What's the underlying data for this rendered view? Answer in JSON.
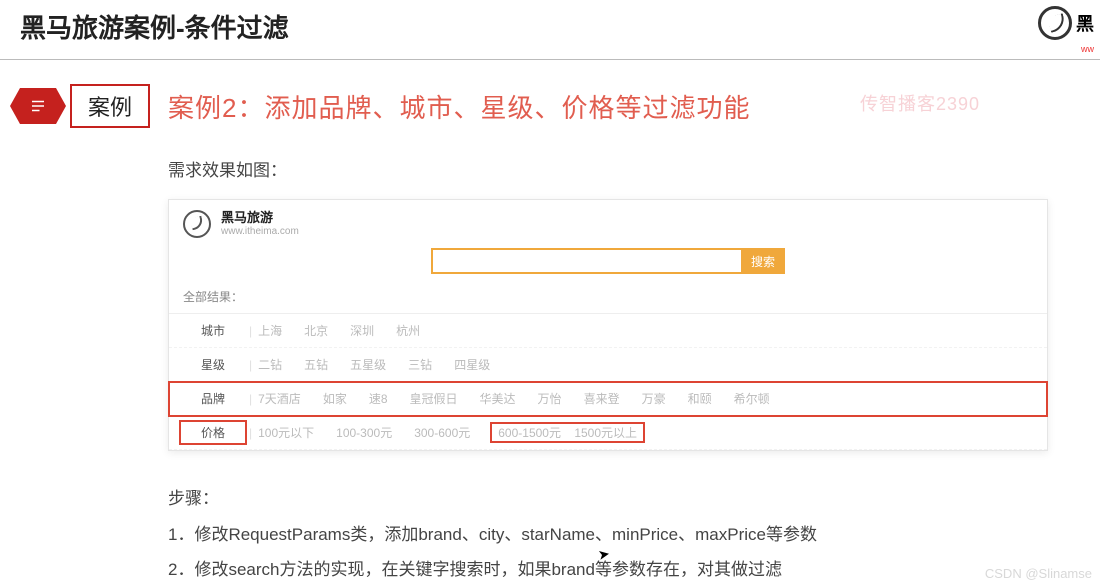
{
  "page_title": "黑马旅游案例-条件过滤",
  "corner_logo_text": "黑",
  "corner_logo_sub": "ww",
  "watermark_tr": "传智播客2390",
  "watermark_br": "CSDN @Slinamse",
  "badge_label": "案例",
  "case_title": "案例2：添加品牌、城市、星级、价格等过滤功能",
  "need_label": "需求效果如图：",
  "screenshot": {
    "brand_name": "黑马旅游",
    "brand_url": "www.itheima.com",
    "search_button": "搜索",
    "all_results": "全部结果：",
    "filters": {
      "city": {
        "label": "城市",
        "values": [
          "上海",
          "北京",
          "深圳",
          "杭州"
        ]
      },
      "star": {
        "label": "星级",
        "values": [
          "二钻",
          "五钻",
          "五星级",
          "三钻",
          "四星级"
        ]
      },
      "brand": {
        "label": "品牌",
        "values": [
          "7天酒店",
          "如家",
          "速8",
          "皇冠假日",
          "华美达",
          "万怡",
          "喜来登",
          "万豪",
          "和颐",
          "希尔顿"
        ]
      },
      "price": {
        "label": "价格",
        "values": [
          "100元以下",
          "100-300元",
          "300-600元",
          "600-1500元",
          "1500元以上"
        ]
      }
    }
  },
  "steps_title": "步骤：",
  "step1": "1．修改RequestParams类，添加brand、city、starName、minPrice、maxPrice等参数",
  "step2": "2．修改search方法的实现，在关键字搜索时，如果brand等参数存在，对其做过滤"
}
